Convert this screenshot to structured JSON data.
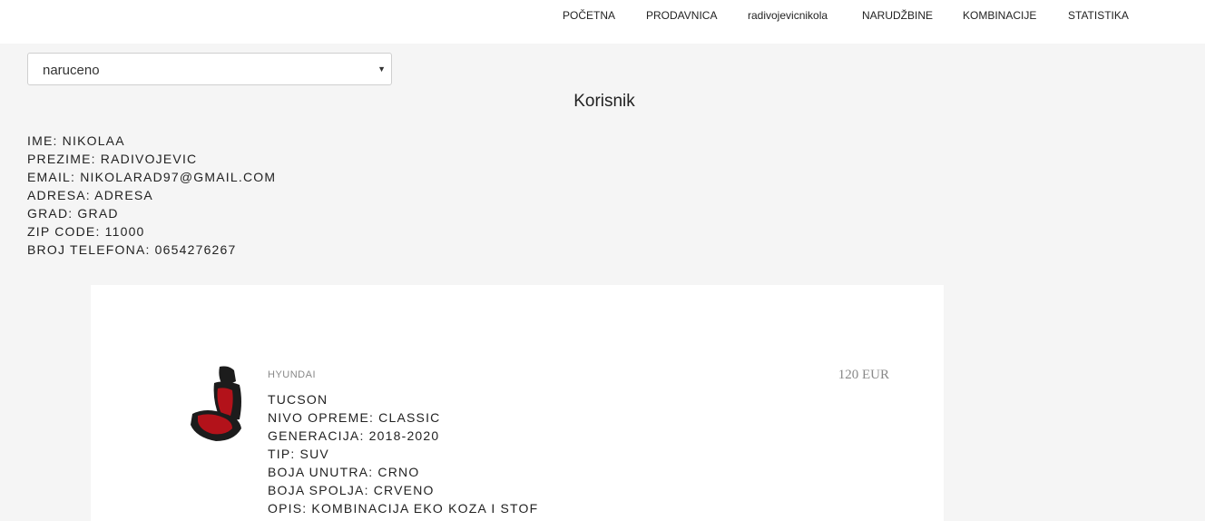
{
  "nav": {
    "items": [
      "POČETNA",
      "PRODAVNICA",
      "radivojevicnikola",
      "NARUDŽBINE",
      "KOMBINACIJE",
      "STATISTIKA"
    ]
  },
  "status_select": {
    "value": "naruceno"
  },
  "section_title": "Korisnik",
  "user": {
    "ime": "IME: NIKOLAA",
    "prezime": "PREZIME: RADIVOJEVIC",
    "email": "EMAIL: NIKOLARAD97@GMAIL.COM",
    "adresa": "ADRESA: ADRESA",
    "grad": "GRAD: GRAD",
    "zip": "ZIP CODE: 11000",
    "telefon": "BROJ TELEFONA: 0654276267"
  },
  "order": {
    "brand": "HYUNDAI",
    "price": "120 EUR",
    "image_icon": "car-seat-icon",
    "model": "TUCSON",
    "nivo": "NIVO OPREME: CLASSIC",
    "generacija": "GENERACIJA: 2018-2020",
    "tip": "TIP: SUV",
    "boja_unutra": "BOJA UNUTRA: CRNO",
    "boja_spolja": "BOJA SPOLJA: CRVENO",
    "opis": "OPIS: KOMBINACIJA EKO KOZA I STOF"
  },
  "colors": {
    "seat_primary": "#b3121a",
    "seat_secondary": "#1c1c1c"
  }
}
